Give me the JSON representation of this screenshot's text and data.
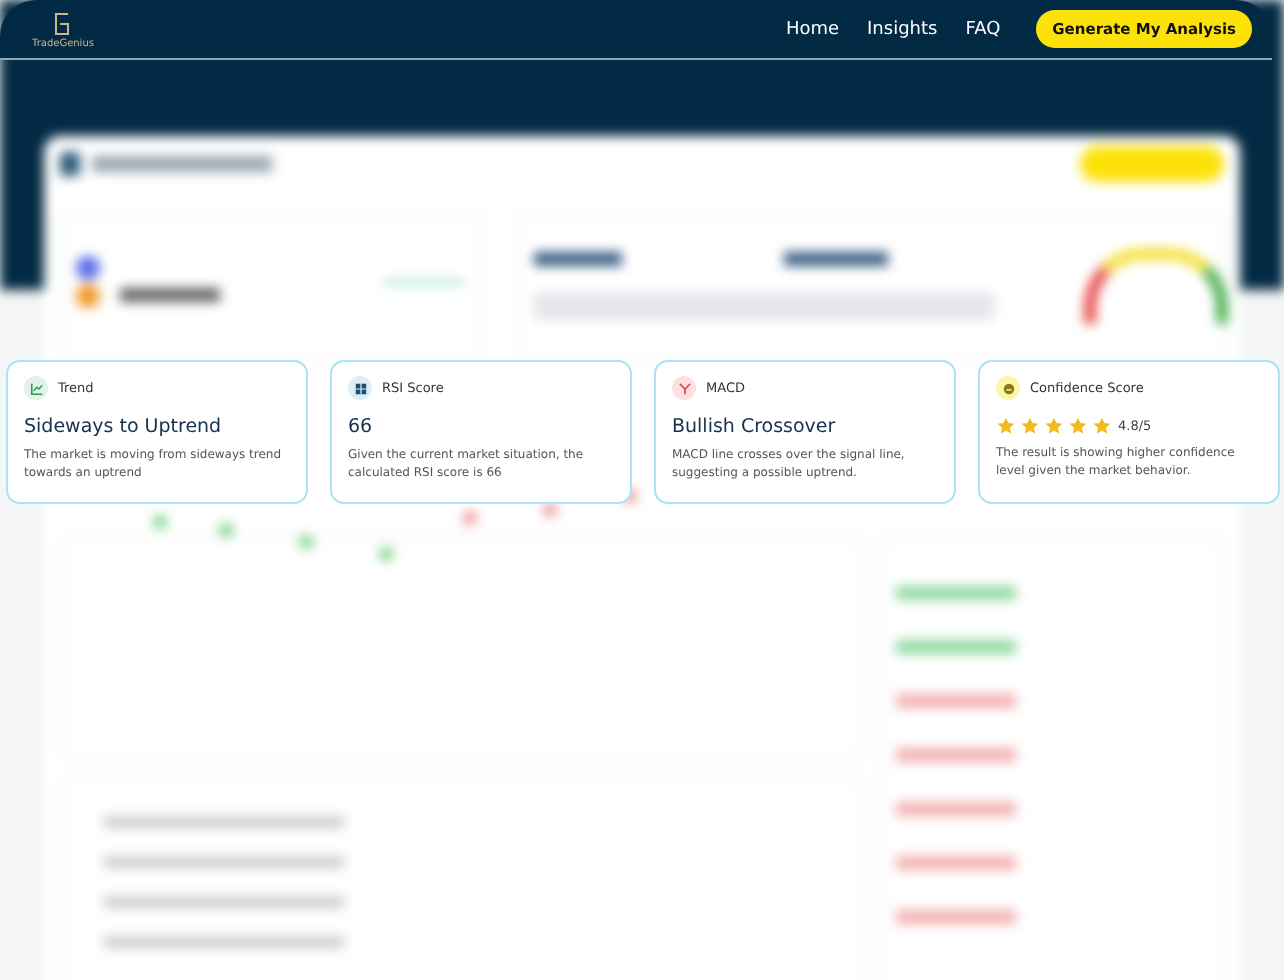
{
  "header": {
    "logo_text": "TradeGenius",
    "nav": [
      "Home",
      "Insights",
      "FAQ"
    ],
    "cta": "Generate My Analysis"
  },
  "cards": [
    {
      "kind": "trend",
      "title": "Trend",
      "value": "Sideways to Uptrend",
      "description": "The market is moving from sideways trend towards an uptrend"
    },
    {
      "kind": "rsi",
      "title": "RSI Score",
      "value": "66",
      "description": "Given the current market situation, the calculated RSI score is 66"
    },
    {
      "kind": "macd",
      "title": "MACD",
      "value": "Bullish Crossover",
      "description": "MACD line crosses over the signal line, suggesting a possible uptrend."
    },
    {
      "kind": "confidence",
      "title": "Confidence Score",
      "stars": 5,
      "rating": "4.8/5",
      "description": "The result is showing higher confidence level given the market behavior."
    }
  ]
}
